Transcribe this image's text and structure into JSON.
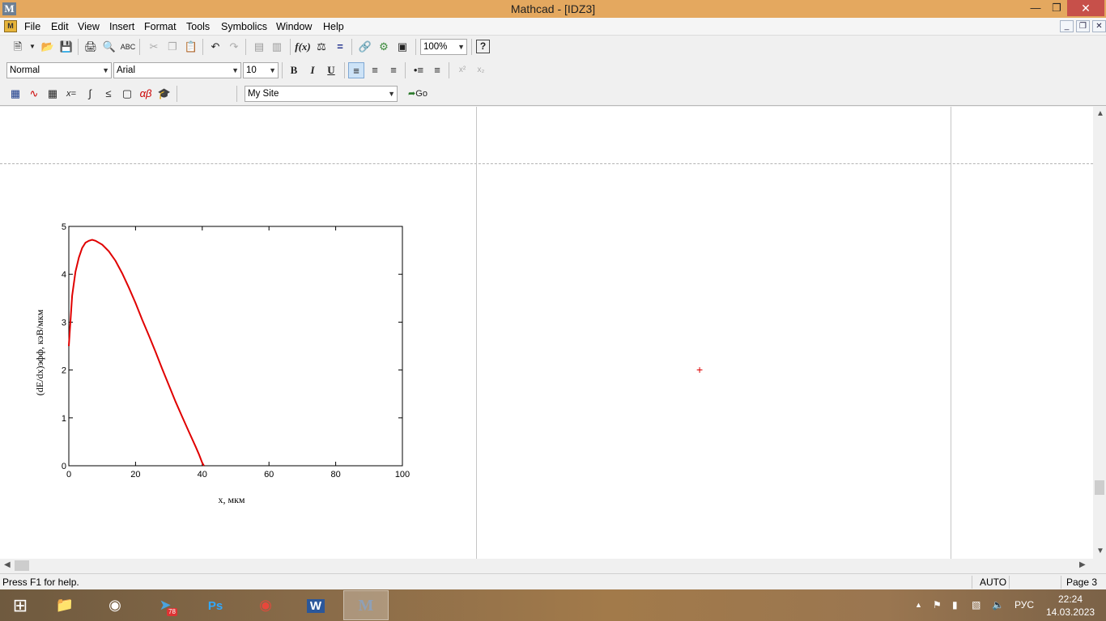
{
  "window": {
    "title": "Mathcad - [IDZ3]",
    "logo": "M",
    "min_icon": "minimize-icon",
    "max_icon": "restore-icon",
    "close_icon": "close-icon"
  },
  "menu": {
    "items": [
      "File",
      "Edit",
      "View",
      "Insert",
      "Format",
      "Tools",
      "Symbolics",
      "Window",
      "Help"
    ]
  },
  "toolbar_standard": {
    "zoom": "100%"
  },
  "toolbar_formatting": {
    "style": "Normal",
    "font": "Arial",
    "size": "10",
    "bold": "B",
    "italic": "I",
    "underline": "U"
  },
  "toolbar_math": {
    "resource": "My Site",
    "go_label": "Go"
  },
  "chart_data": {
    "type": "line",
    "xlabel": "x, мкм",
    "ylabel": "(dE/dx)эфф, кэВ/мкм",
    "xlim": [
      0,
      100
    ],
    "ylim": [
      0,
      5
    ],
    "xticks": [
      "0",
      "20",
      "40",
      "60",
      "80",
      "100"
    ],
    "yticks": [
      "0",
      "1",
      "2",
      "3",
      "4",
      "5"
    ],
    "series": [
      {
        "color": "#e00000",
        "x": [
          0,
          1,
          2,
          3,
          4,
          5,
          6,
          7,
          8,
          10,
          12,
          14,
          16,
          18,
          20,
          22,
          24,
          26,
          28,
          30,
          32,
          34,
          36,
          38,
          39,
          40,
          40.5
        ],
        "y": [
          2.5,
          3.55,
          4.05,
          4.35,
          4.55,
          4.66,
          4.7,
          4.72,
          4.7,
          4.62,
          4.48,
          4.28,
          4.02,
          3.72,
          3.4,
          3.05,
          2.72,
          2.38,
          2.02,
          1.68,
          1.34,
          1.02,
          0.71,
          0.4,
          0.24,
          0.06,
          0.0
        ]
      }
    ]
  },
  "status": {
    "help": "Press F1 for help.",
    "mode": "AUTO",
    "page": "Page 3"
  },
  "taskbar": {
    "language": "РУС",
    "time": "22:24",
    "date": "14.03.2023",
    "telegram_badge": "78"
  }
}
